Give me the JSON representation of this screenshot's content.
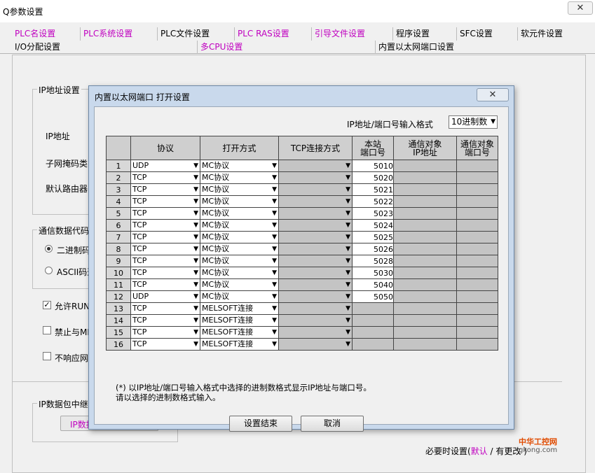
{
  "window": {
    "title": "Q参数设置",
    "close_glyph": "✕"
  },
  "tabs_row1": [
    {
      "label": "PLC名设置",
      "pink": true
    },
    {
      "label": "PLC系统设置",
      "pink": true
    },
    {
      "label": "PLC文件设置",
      "pink": false
    },
    {
      "label": "PLC RAS设置",
      "pink": true
    },
    {
      "label": "引导文件设置",
      "pink": true
    },
    {
      "label": "程序设置",
      "pink": false
    },
    {
      "label": "SFC设置",
      "pink": false
    },
    {
      "label": "软元件设置",
      "pink": false
    }
  ],
  "tabs_row2": [
    {
      "label": "I/O分配设置",
      "pink": false
    },
    {
      "label": "多CPU设置",
      "pink": true
    },
    {
      "label": "内置以太网端口设置",
      "pink": false
    }
  ],
  "background": {
    "ip_group": "IP地址设置",
    "ip_label": "IP地址",
    "subnet_label": "子网掩码类",
    "gateway_label": "默认路由器",
    "comm_group": "通信数据代码",
    "binary_label": "二进制码",
    "ascii_label": "ASCII码通",
    "check_run": "允许RUN",
    "check_me": "禁止与ME",
    "check_noresp": "不响应网",
    "relay_group": "IP数据包中继",
    "relay_button": "IP数据",
    "bottom_prefix": "必要时设置(",
    "bottom_default": "默认",
    "bottom_sep": " /",
    "bottom_changed": "有更改",
    "bottom_suffix": " )"
  },
  "watermark": {
    "line1": "中华工控网",
    "line2": "gkong.com"
  },
  "dialog": {
    "title": "内置以太网端口 打开设置",
    "close_glyph": "✕",
    "format_label": "IP地址/端口号输入格式",
    "format_value": "10进制数",
    "headers": {
      "protocol": "协议",
      "open_method": "打开方式",
      "tcp_mode": "TCP连接方式",
      "local_port_l1": "本站",
      "local_port_l2": "端口号",
      "target_ip_l1": "通信对象",
      "target_ip_l2": "IP地址",
      "target_port_l1": "通信对象",
      "target_port_l2": "端口号"
    },
    "rows": [
      {
        "no": "1",
        "protocol": "UDP",
        "open": "MC协议",
        "port": "5010"
      },
      {
        "no": "2",
        "protocol": "TCP",
        "open": "MC协议",
        "port": "5020"
      },
      {
        "no": "3",
        "protocol": "TCP",
        "open": "MC协议",
        "port": "5021"
      },
      {
        "no": "4",
        "protocol": "TCP",
        "open": "MC协议",
        "port": "5022"
      },
      {
        "no": "5",
        "protocol": "TCP",
        "open": "MC协议",
        "port": "5023"
      },
      {
        "no": "6",
        "protocol": "TCP",
        "open": "MC协议",
        "port": "5024"
      },
      {
        "no": "7",
        "protocol": "TCP",
        "open": "MC协议",
        "port": "5025"
      },
      {
        "no": "8",
        "protocol": "TCP",
        "open": "MC协议",
        "port": "5026"
      },
      {
        "no": "9",
        "protocol": "TCP",
        "open": "MC协议",
        "port": "5028"
      },
      {
        "no": "10",
        "protocol": "TCP",
        "open": "MC协议",
        "port": "5030"
      },
      {
        "no": "11",
        "protocol": "TCP",
        "open": "MC协议",
        "port": "5040"
      },
      {
        "no": "12",
        "protocol": "UDP",
        "open": "MC协议",
        "port": "5050"
      },
      {
        "no": "13",
        "protocol": "TCP",
        "open": "MELSOFT连接",
        "port": ""
      },
      {
        "no": "14",
        "protocol": "TCP",
        "open": "MELSOFT连接",
        "port": ""
      },
      {
        "no": "15",
        "protocol": "TCP",
        "open": "MELSOFT连接",
        "port": ""
      },
      {
        "no": "16",
        "protocol": "TCP",
        "open": "MELSOFT连接",
        "port": ""
      }
    ],
    "note_line1": "(*) 以IP地址/端口号输入格式中选择的进制数格式显示IP地址与端口号。",
    "note_line2": "请以选择的进制数格式输入。",
    "ok_button": "设置结束",
    "cancel_button": "取消",
    "dropdown_glyph": "▼"
  }
}
